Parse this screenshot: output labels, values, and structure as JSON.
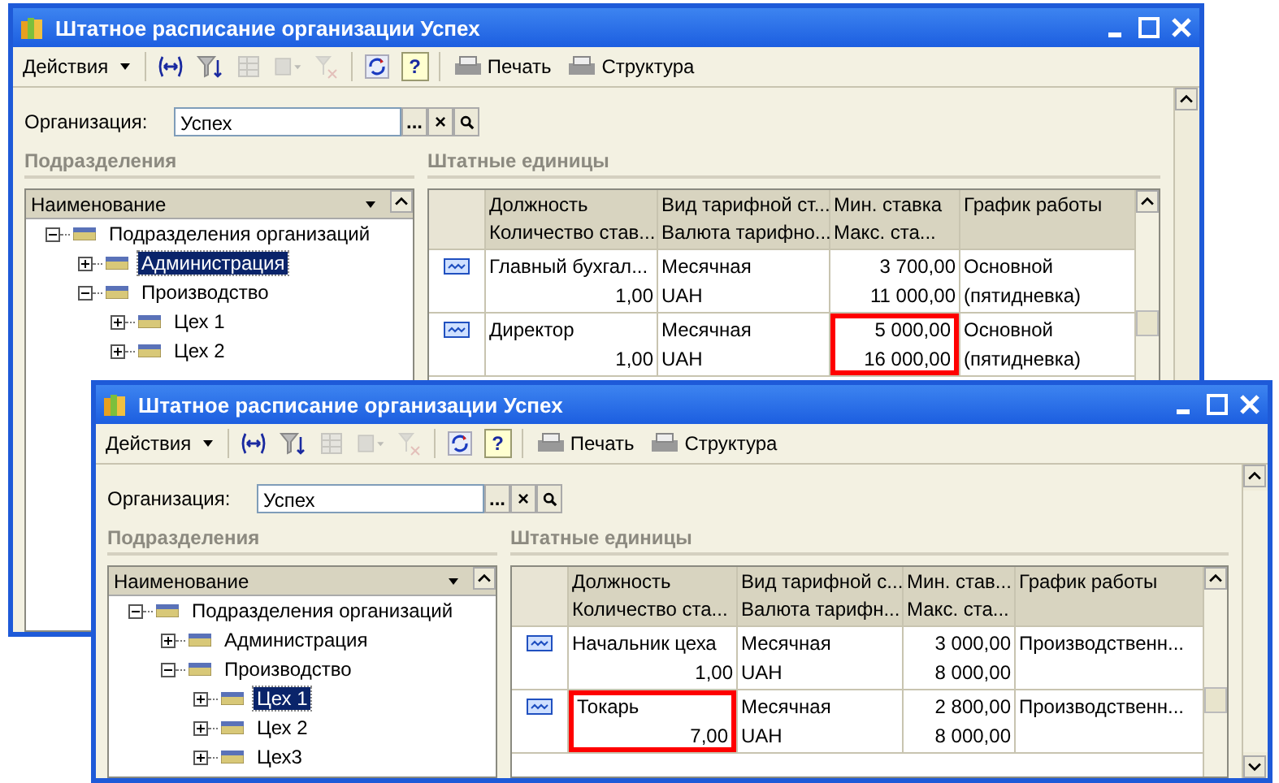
{
  "windows": [
    {
      "title": "Штатное расписание организации Успех",
      "toolbar": {
        "actions": "Действия",
        "help": "?",
        "print": "Печать",
        "structure": "Структура"
      },
      "organization": {
        "label": "Организация:",
        "value": "Успех",
        "select_button": "...",
        "clear_button": "×"
      },
      "departments": {
        "title": "Подразделения",
        "column": "Наименование",
        "tree": [
          {
            "label": "Подразделения организаций",
            "expanded": true,
            "selected": false,
            "children": [
              {
                "label": "Администрация",
                "expanded": false,
                "selected": true
              },
              {
                "label": "Производство",
                "expanded": true,
                "selected": false,
                "children": [
                  {
                    "label": "Цех 1",
                    "expanded": false,
                    "selected": false
                  },
                  {
                    "label": "Цех 2",
                    "expanded": false,
                    "selected": false
                  }
                ]
              }
            ]
          }
        ]
      },
      "staff_units": {
        "title": "Штатные единицы",
        "columns": [
          {
            "top": "Должность",
            "bottom": "Количество став..."
          },
          {
            "top": "Вид тарифной ст...",
            "bottom": "Валюта тарифно..."
          },
          {
            "top": "Мин. ставка",
            "bottom": "Макс. ста..."
          },
          {
            "top": "График работы"
          }
        ],
        "rows": [
          {
            "position": "Главный бухгал...",
            "count": "1,00",
            "rate_type": "Месячная",
            "currency": "UAH",
            "min_rate": "3 700,00",
            "max_rate": "11 000,00",
            "schedule": "Основной (пятидневка)",
            "position_highlighted": false,
            "rates_highlighted": false
          },
          {
            "position": "Директор",
            "count": "1,00",
            "rate_type": "Месячная",
            "currency": "UAH",
            "min_rate": "5 000,00",
            "max_rate": "16 000,00",
            "schedule": "Основной (пятидневка)",
            "position_highlighted": false,
            "rates_highlighted": true
          }
        ]
      }
    },
    {
      "title": "Штатное расписание организации Успех",
      "toolbar": {
        "actions": "Действия",
        "help": "?",
        "print": "Печать",
        "structure": "Структура"
      },
      "organization": {
        "label": "Организация:",
        "value": "Успех",
        "select_button": "...",
        "clear_button": "×"
      },
      "departments": {
        "title": "Подразделения",
        "column": "Наименование",
        "tree": [
          {
            "label": "Подразделения организаций",
            "expanded": true,
            "selected": false,
            "children": [
              {
                "label": "Администрация",
                "expanded": false,
                "selected": false
              },
              {
                "label": "Производство",
                "expanded": true,
                "selected": false,
                "children": [
                  {
                    "label": "Цех 1",
                    "expanded": false,
                    "selected": true
                  },
                  {
                    "label": "Цех 2",
                    "expanded": false,
                    "selected": false
                  },
                  {
                    "label": "Цех3",
                    "expanded": false,
                    "selected": false
                  }
                ]
              }
            ]
          }
        ]
      },
      "staff_units": {
        "title": "Штатные единицы",
        "columns": [
          {
            "top": "Должность",
            "bottom": "Количество ста..."
          },
          {
            "top": "Вид тарифной с...",
            "bottom": "Валюта тарифн..."
          },
          {
            "top": "Мин. став...",
            "bottom": "Макс. ста..."
          },
          {
            "top": "График работы"
          }
        ],
        "rows": [
          {
            "position": "Начальник цеха",
            "count": "1,00",
            "rate_type": "Месячная",
            "currency": "UAH",
            "min_rate": "3 000,00",
            "max_rate": "8 000,00",
            "schedule": "Производственн...",
            "position_highlighted": false,
            "rates_highlighted": false
          },
          {
            "position": "Токарь",
            "count": "7,00",
            "rate_type": "Месячная",
            "currency": "UAH",
            "min_rate": "2 800,00",
            "max_rate": "8 000,00",
            "schedule": "Производственн...",
            "position_highlighted": true,
            "rates_highlighted": false
          }
        ]
      }
    }
  ]
}
